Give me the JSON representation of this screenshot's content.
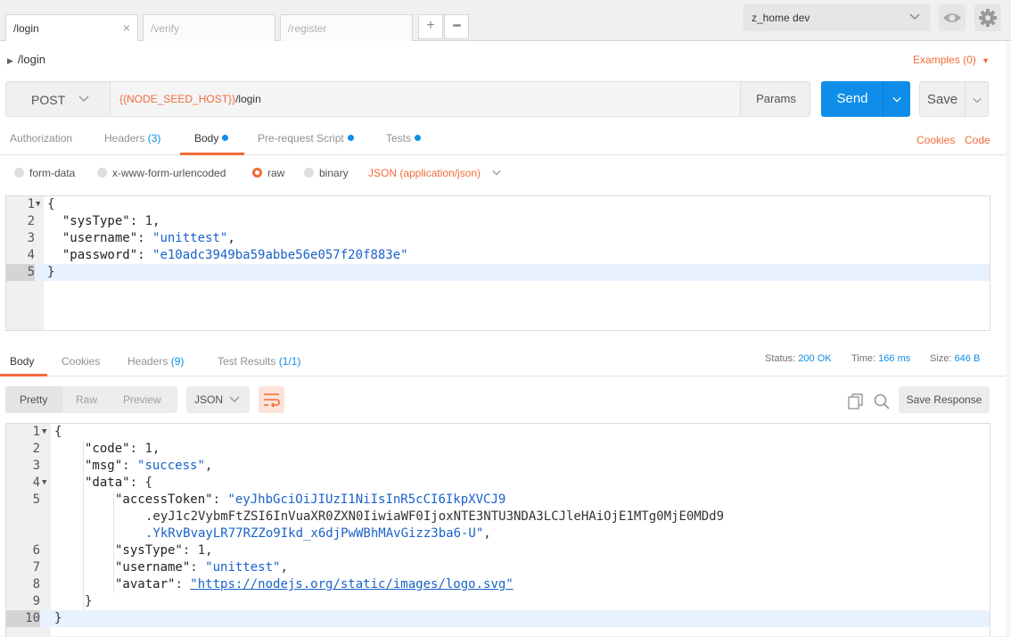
{
  "tabs": [
    {
      "label": "/login",
      "active": true
    },
    {
      "label": "/verify",
      "active": false
    },
    {
      "label": "/register",
      "active": false
    }
  ],
  "tab_icons": {
    "add": "+",
    "more": "•••",
    "close": "×"
  },
  "environment": {
    "selected": "z_home dev"
  },
  "breadcrumb": "/login",
  "examples_label": "Examples (0)",
  "request": {
    "method": "POST",
    "url_var": "{{NODE_SEED_HOST}}",
    "url_path": "/login",
    "params_label": "Params",
    "send_label": "Send",
    "save_label": "Save"
  },
  "request_tabs": {
    "authorization": "Authorization",
    "headers": "Headers",
    "headers_count": "(3)",
    "body": "Body",
    "prerequest": "Pre-request Script",
    "tests": "Tests",
    "cookies": "Cookies",
    "code": "Code"
  },
  "body_modes": {
    "form_data": "form-data",
    "urlencoded": "x-www-form-urlencoded",
    "raw": "raw",
    "binary": "binary",
    "content_type": "JSON (application/json)"
  },
  "request_body": {
    "line_numbers": [
      "1",
      "2",
      "3",
      "4",
      "5"
    ],
    "lines": [
      {
        "p1": "{"
      },
      {
        "indent": "  ",
        "key": "\"sysType\"",
        "sep": ": ",
        "val": "1",
        "end": ",",
        "type": "n"
      },
      {
        "indent": "  ",
        "key": "\"username\"",
        "sep": ": ",
        "val": "\"unittest\"",
        "end": ",",
        "type": "s"
      },
      {
        "indent": "  ",
        "key": "\"password\"",
        "sep": ": ",
        "val": "\"e10adc3949ba59abbe56e057f20f883e\"",
        "end": "",
        "type": "s"
      },
      {
        "p1": "}"
      }
    ]
  },
  "response_tabs": {
    "body": "Body",
    "cookies": "Cookies",
    "headers": "Headers",
    "headers_count": "(9)",
    "test_results": "Test Results",
    "test_count": "(1/1)"
  },
  "response_status": {
    "status_label": "Status:",
    "status_value": "200 OK",
    "time_label": "Time:",
    "time_value": "166 ms",
    "size_label": "Size:",
    "size_value": "646 B"
  },
  "response_view": {
    "pretty": "Pretty",
    "raw": "Raw",
    "preview": "Preview",
    "format": "JSON",
    "save_response": "Save Response"
  },
  "response_body": {
    "line_numbers": [
      "1",
      "2",
      "3",
      "4",
      "5",
      "",
      "",
      "6",
      "7",
      "8",
      "9",
      "10"
    ],
    "line_l1": "{",
    "line_l2_key": "\"code\"",
    "line_l2_val": "1",
    "line_l3_key": "\"msg\"",
    "line_l3_val": "\"success\"",
    "line_l4_key": "\"data\"",
    "line_l4_brace": "{",
    "line_l5_key": "\"accessToken\"",
    "token_part1": "\"eyJhbGciOiJIUzI1NiIsInR5cCI6IkpXVCJ9",
    "token_part2": ".eyJ1c2VybmFtZSI6InVuaXR0ZXN0IiwiaWF0IjoxNTE3NTU3NDA3LCJleHAiOjE1MTg0MjE0MDd9",
    "token_part3": ".YkRvBvayLR77RZZo9Ikd_x6djPwWBhMAvGizz3ba6-U\"",
    "line_l6_key": "\"sysType\"",
    "line_l6_val": "1",
    "line_l7_key": "\"username\"",
    "line_l7_val": "\"unittest\"",
    "line_l8_key": "\"avatar\"",
    "line_l8_val": "\"https://nodejs.org/static/images/logo.svg\"",
    "line_l9": "}",
    "line_l10": "}"
  },
  "colors": {
    "accent": "#f26b3a",
    "primary": "#0e8ee9",
    "string": "#1a62c9"
  }
}
